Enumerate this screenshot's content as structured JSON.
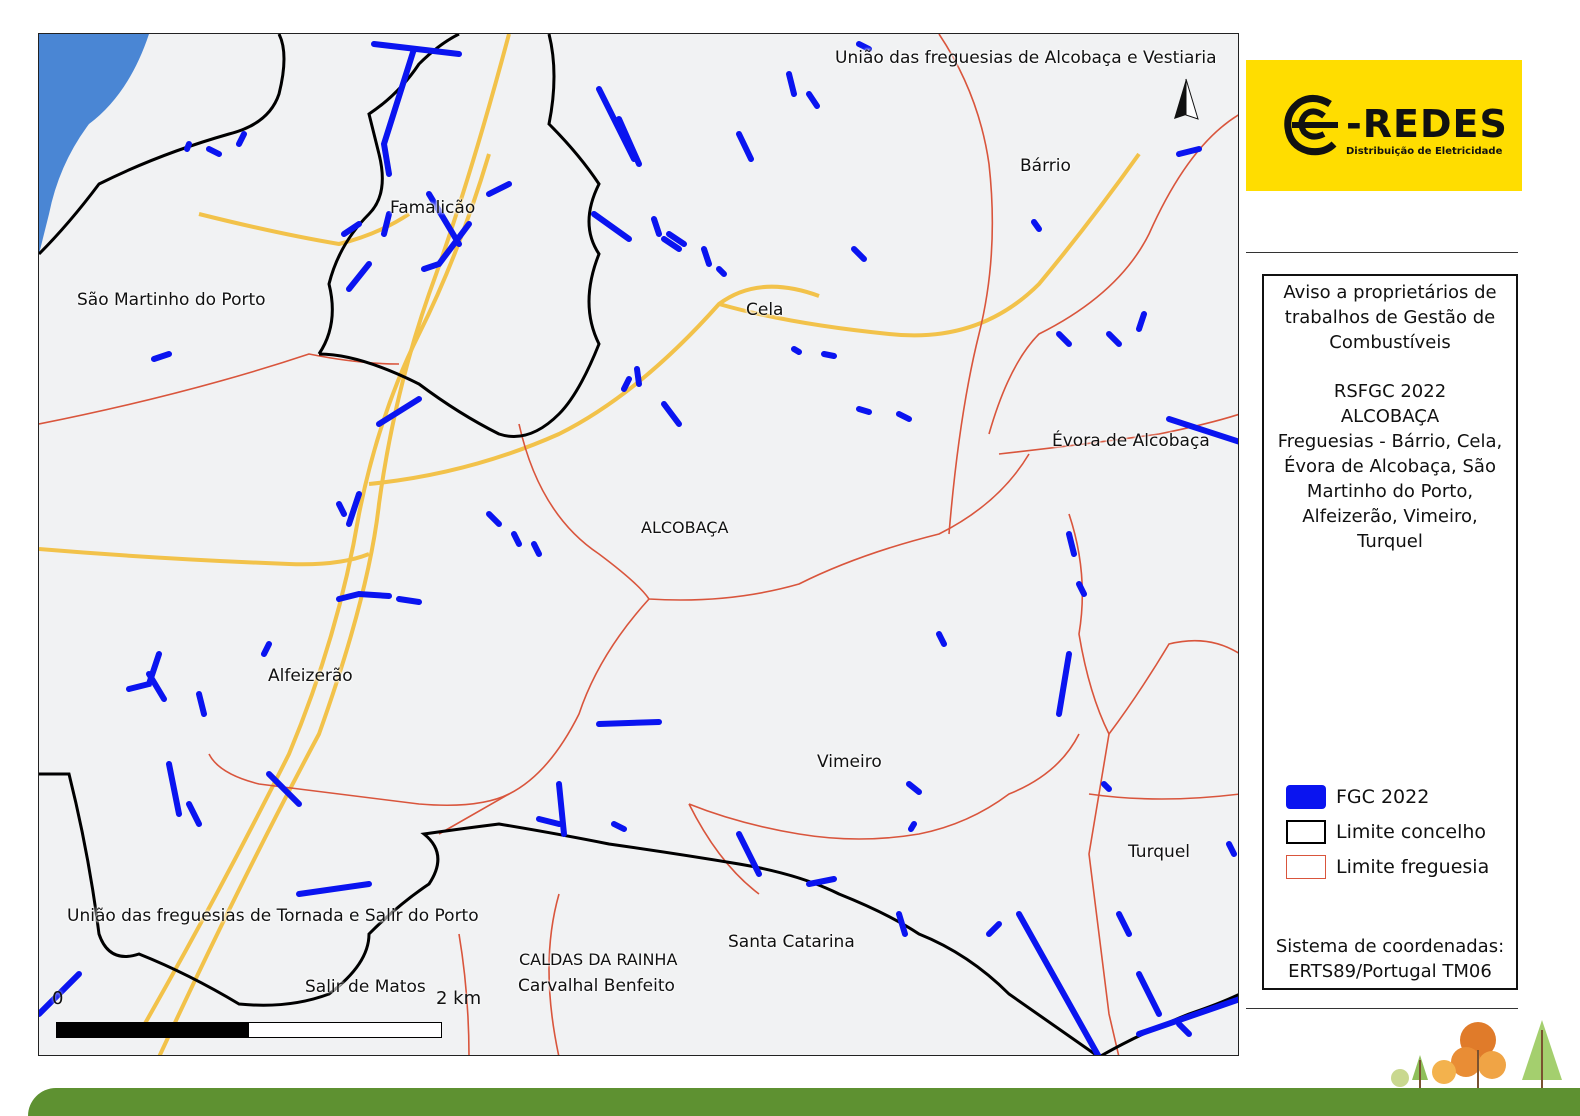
{
  "map": {
    "places": [
      {
        "id": "uniao-alcobaca-vestiaria",
        "text": "União das freguesias de Alcobaça e Vestiaria"
      },
      {
        "id": "barrio",
        "text": "Bárrio"
      },
      {
        "id": "famalicao",
        "text": "Famalicão"
      },
      {
        "id": "sao-martinho",
        "text": "São Martinho do Porto"
      },
      {
        "id": "cela",
        "text": "Cela"
      },
      {
        "id": "evora",
        "text": "Évora de Alcobaça"
      },
      {
        "id": "alcobaca",
        "text": "ALCOBAÇA"
      },
      {
        "id": "alfeizerao",
        "text": "Alfeizerão"
      },
      {
        "id": "vimeiro",
        "text": "Vimeiro"
      },
      {
        "id": "turquel",
        "text": "Turquel"
      },
      {
        "id": "uniao-tornada",
        "text": "União das freguesias de Tornada e Salir do Porto"
      },
      {
        "id": "caldas-rainha",
        "text": "CALDAS DA RAINHA"
      },
      {
        "id": "carvalhal-benfeito",
        "text": "Carvalhal Benfeito"
      },
      {
        "id": "santa-catarina",
        "text": "Santa Catarina"
      },
      {
        "id": "salir-matos",
        "text": "Salir de Matos"
      }
    ],
    "scale": {
      "start": "0",
      "end": "2 km"
    },
    "colors": {
      "fgc": "#0a14f0",
      "concelho": "#000000",
      "freguesia": "#d9553c",
      "roads": "#f2c24a",
      "sea": "#4a86d4"
    }
  },
  "logo": {
    "name": "-REDES",
    "subtitle": "Distribuição de Eletricidade",
    "color": "#ffdd00"
  },
  "notice": {
    "line1": "Aviso a proprietários de",
    "line2": "trabalhos de Gestão de",
    "line3": "Combustíveis",
    "line4": "RSFGC 2022",
    "line5": "ALCOBAÇA",
    "line6": "Freguesias - Bárrio, Cela,",
    "line7": "Évora de Alcobaça, São",
    "line8": "Martinho do Porto,",
    "line9": "Alfeizerão, Vimeiro,",
    "line10": "Turquel"
  },
  "legend": {
    "fgc": "FGC 2022",
    "concelho": "Limite concelho",
    "freguesia": "Limite freguesia"
  },
  "crs": {
    "line1": "Sistema de coordenadas:",
    "line2": "ERTS89/Portugal TM06"
  }
}
